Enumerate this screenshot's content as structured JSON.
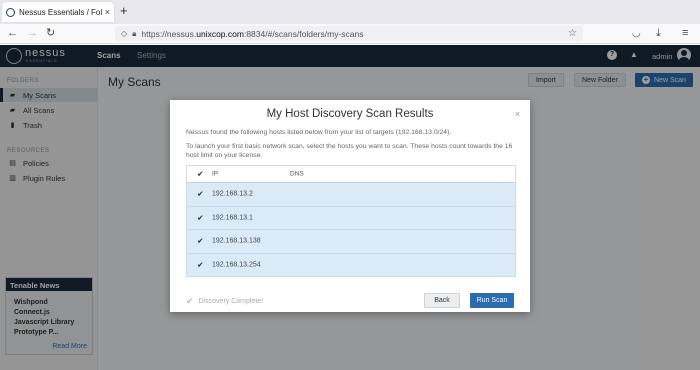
{
  "browser": {
    "tab_title": "Nessus Essentials / Folde",
    "tab_close": "×",
    "new_tab": "+",
    "url_prefix": "https://nessus.",
    "url_domain": "unixcop.com",
    "url_suffix": ":8834/#/scans/folders/my-scans"
  },
  "header": {
    "logo_text": "nessus",
    "logo_sub": "ESSENTIALS",
    "nav": [
      "Scans",
      "Settings"
    ],
    "username": "admin"
  },
  "sidebar": {
    "folders_heading": "FOLDERS",
    "folders": [
      {
        "label": "My Scans",
        "icon": "folder-open-icon"
      },
      {
        "label": "All Scans",
        "icon": "folders-icon"
      },
      {
        "label": "Trash",
        "icon": "trash-icon"
      }
    ],
    "resources_heading": "RESOURCES",
    "resources": [
      {
        "label": "Policies",
        "icon": "policies-icon"
      },
      {
        "label": "Plugin Rules",
        "icon": "plugin-rules-icon"
      }
    ],
    "news": {
      "title": "Tenable News",
      "line1": "Wishpond Connect.js",
      "line2": "Javascript Library",
      "line3": "Prototype P...",
      "more": "Read More"
    }
  },
  "main": {
    "title": "My Scans",
    "import_label": "Import",
    "new_folder_label": "New Folder",
    "new_scan_label": "New Scan"
  },
  "modal": {
    "title": "My Host Discovery Scan Results",
    "close": "×",
    "intro": "Nessus found the following hosts listed below from your list of targets (192.168.13.0/24).",
    "instructions": "To launch your first basic network scan, select the hosts you want to scan. These hosts count towards the 16 host limit on your license.",
    "columns": {
      "ip": "IP",
      "dns": "DNS"
    },
    "rows": [
      {
        "ip": "192.168.13.2",
        "dns": "",
        "checked": true
      },
      {
        "ip": "192.168.13.1",
        "dns": "",
        "checked": true
      },
      {
        "ip": "192.168.13.138",
        "dns": "",
        "checked": true
      },
      {
        "ip": "192.168.13.254",
        "dns": "",
        "checked": true
      }
    ],
    "status": "Discovery Complete!",
    "back_label": "Back",
    "run_label": "Run Scan"
  },
  "colors": {
    "header_bg": "#1a2b3c",
    "primary_button": "#2b6cb0",
    "row_highlight": "#daeaf6"
  }
}
